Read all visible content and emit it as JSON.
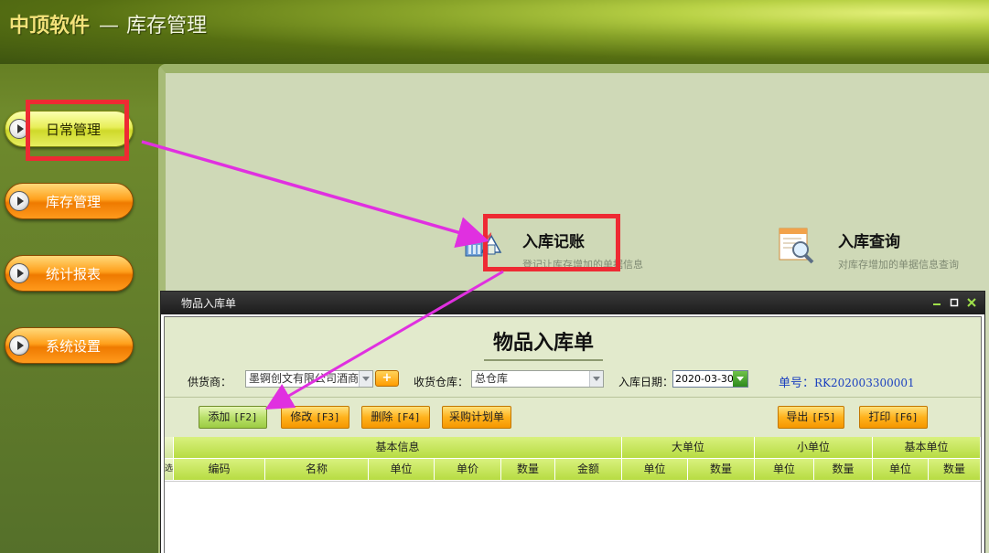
{
  "app": {
    "brand": "中顶软件",
    "separator": "—",
    "module": "库存管理"
  },
  "nav": {
    "items": [
      {
        "label": "日常管理",
        "active": true
      },
      {
        "label": "库存管理",
        "active": false
      },
      {
        "label": "统计报表",
        "active": false
      },
      {
        "label": "系统设置",
        "active": false
      }
    ]
  },
  "tiles": [
    {
      "title": "入库记账",
      "desc": "登记让库存增加的单据信息",
      "icon": "warehouse-in-icon"
    },
    {
      "title": "入库查询",
      "desc": "对库存增加的单据信息查询",
      "icon": "search-document-icon"
    }
  ],
  "dialog": {
    "window_title": "物品入库单",
    "form_title": "物品入库单",
    "supplier": {
      "label": "供货商：",
      "value": "墨锕创文有限公司酒商"
    },
    "add_supplier_label": "+",
    "warehouse": {
      "label": "收货仓库：",
      "value": "总仓库"
    },
    "date": {
      "label": "入库日期：",
      "value": "2020-03-30"
    },
    "order_no": {
      "label": "单号：",
      "value": "RK202003300001"
    },
    "toolbar": {
      "add": {
        "label": "添加",
        "key": "[F2]"
      },
      "edit": {
        "label": "修改",
        "key": "[F3]"
      },
      "delete": {
        "label": "删除",
        "key": "[F4]"
      },
      "plan": {
        "label": "采购计划单"
      },
      "export": {
        "label": "导出",
        "key": "[F5]"
      },
      "print": {
        "label": "打印",
        "key": "[F6]"
      }
    },
    "grid": {
      "selector": "选",
      "groups": [
        "基本信息",
        "大单位",
        "小单位",
        "基本单位"
      ],
      "columns": [
        "编码",
        "名称",
        "单位",
        "单价",
        "数量",
        "金额",
        "单位",
        "数量",
        "单位",
        "数量",
        "单位",
        "数量"
      ]
    }
  },
  "colors": {
    "highlight": "#ee2a33",
    "arrow": "#e030e0",
    "order_no": "#1a3fbf"
  }
}
